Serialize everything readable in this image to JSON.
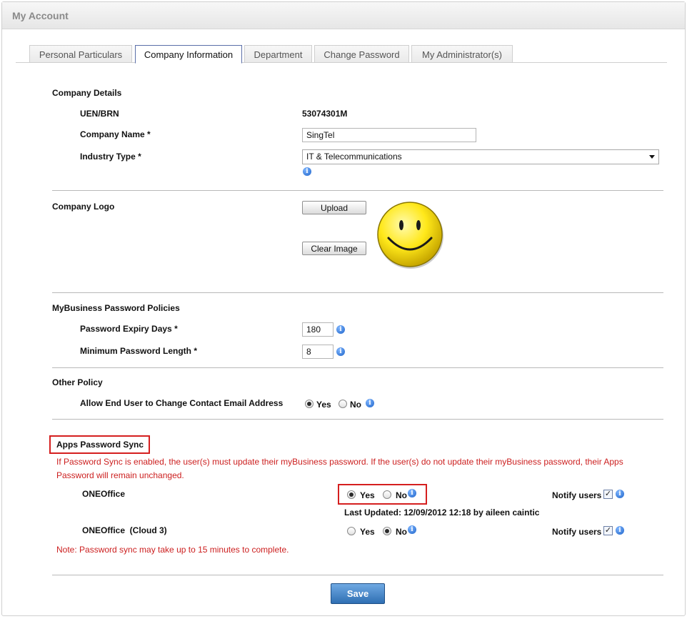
{
  "header": {
    "title": "My Account"
  },
  "tabs": [
    {
      "label": "Personal Particulars",
      "active": false
    },
    {
      "label": "Company Information",
      "active": true
    },
    {
      "label": "Department",
      "active": false
    },
    {
      "label": "Change Password",
      "active": false
    },
    {
      "label": "My Administrator(s)",
      "active": false
    }
  ],
  "company_details": {
    "section_title": "Company Details",
    "uen_label": "UEN/BRN",
    "uen_value": "53074301M",
    "company_name_label": "Company Name *",
    "company_name_value": "SingTel",
    "industry_label": "Industry Type *",
    "industry_value": "IT & Telecommunications"
  },
  "company_logo": {
    "section_title": "Company Logo",
    "upload_label": "Upload",
    "clear_label": "Clear Image"
  },
  "password_policies": {
    "section_title": "MyBusiness Password Policies",
    "expiry_label": "Password Expiry Days *",
    "expiry_value": "180",
    "min_length_label": "Minimum Password Length *",
    "min_length_value": "8"
  },
  "other_policy": {
    "section_title": "Other Policy",
    "allow_email_label": "Allow End User to Change Contact Email Address",
    "yes_label": "Yes",
    "no_label": "No",
    "selected": "Yes"
  },
  "apps_sync": {
    "section_title": "Apps Password Sync",
    "warning_line1": "If Password Sync is enabled, the user(s) must update their myBusiness password. If the user(s) do not update their myBusiness password, their Apps",
    "warning_line2": "Password will remain unchanged.",
    "apps": [
      {
        "name": "ONEOffice",
        "yes_label": "Yes",
        "no_label": "No",
        "selected": "Yes",
        "notify_label": "Notify users",
        "notify_checked": true,
        "last_updated": "Last Updated: 12/09/2012 12:18 by aileen caintic"
      },
      {
        "name": "ONEOffice  (Cloud 3)",
        "yes_label": "Yes",
        "no_label": "No",
        "selected": "No",
        "notify_label": "Notify users",
        "notify_checked": true
      }
    ],
    "note": "Note: Password sync may take up to 15 minutes to complete."
  },
  "save_label": "Save",
  "icons": {
    "info": "info-icon",
    "logo": "smiley-face-icon",
    "dropdown": "chevron-down-icon",
    "check": "checkmark-icon"
  }
}
